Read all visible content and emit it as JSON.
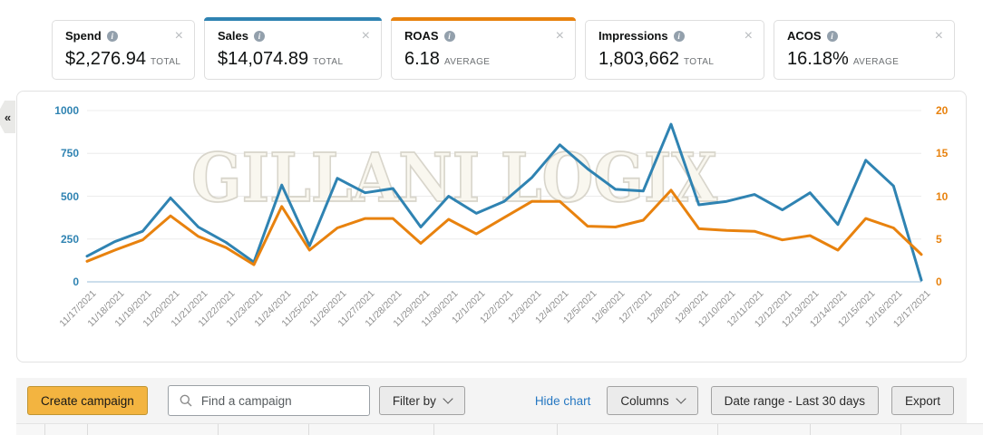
{
  "metrics": {
    "cards": [
      {
        "label": "Spend",
        "value": "$2,276.94",
        "suffix": "TOTAL",
        "accent": ""
      },
      {
        "label": "Sales",
        "value": "$14,074.89",
        "suffix": "TOTAL",
        "accent": "#2f83b2"
      },
      {
        "label": "ROAS",
        "value": "6.18",
        "suffix": "AVERAGE",
        "accent": "#e8820e"
      },
      {
        "label": "Impressions",
        "value": "1,803,662",
        "suffix": "TOTAL",
        "accent": ""
      },
      {
        "label": "ACOS",
        "value": "16.18%",
        "suffix": "AVERAGE",
        "accent": ""
      }
    ],
    "info_icon": "i",
    "close_icon": "×"
  },
  "chart_panel": {
    "collapse_icon": "«"
  },
  "chart_data": {
    "type": "line",
    "x": [
      "11/17/2021",
      "11/18/2021",
      "11/19/2021",
      "11/20/2021",
      "11/21/2021",
      "11/22/2021",
      "11/23/2021",
      "11/24/2021",
      "11/25/2021",
      "11/26/2021",
      "11/27/2021",
      "11/28/2021",
      "11/29/2021",
      "11/30/2021",
      "12/1/2021",
      "12/2/2021",
      "12/3/2021",
      "12/4/2021",
      "12/5/2021",
      "12/6/2021",
      "12/7/2021",
      "12/8/2021",
      "12/9/2021",
      "12/10/2021",
      "12/11/2021",
      "12/12/2021",
      "12/13/2021",
      "12/14/2021",
      "12/15/2021",
      "12/16/2021",
      "12/17/2021"
    ],
    "series": [
      {
        "name": "Sales",
        "axis": "left",
        "color": "#2f83b2",
        "values": [
          150,
          235,
          295,
          490,
          320,
          230,
          115,
          565,
          210,
          605,
          520,
          545,
          320,
          500,
          400,
          470,
          610,
          800,
          660,
          540,
          530,
          920,
          450,
          470,
          510,
          420,
          520,
          335,
          710,
          560,
          10
        ]
      },
      {
        "name": "ROAS",
        "axis": "right",
        "color": "#e8820e",
        "values": [
          2.4,
          3.7,
          4.9,
          7.7,
          5.3,
          4.0,
          2.0,
          8.8,
          3.7,
          6.3,
          7.4,
          7.4,
          4.5,
          7.3,
          5.6,
          7.5,
          9.4,
          9.4,
          6.5,
          6.4,
          7.2,
          10.7,
          6.2,
          6.0,
          5.9,
          4.9,
          5.4,
          3.7,
          7.4,
          6.3,
          3.2
        ]
      }
    ],
    "left_axis": {
      "ticks": [
        0,
        250,
        500,
        750,
        1000
      ],
      "range": [
        0,
        1000
      ],
      "color": "#2f83b2"
    },
    "right_axis": {
      "ticks": [
        0,
        5,
        10,
        15,
        20
      ],
      "range": [
        0,
        20
      ],
      "color": "#e8820e"
    },
    "watermark": "GILLANI LOGIX",
    "grid": true,
    "legend": "none"
  },
  "toolbar": {
    "create_campaign_label": "Create campaign",
    "search_placeholder": "Find a campaign",
    "filter_by_label": "Filter by",
    "hide_chart_label": "Hide chart",
    "columns_label": "Columns",
    "date_range_label": "Date range - Last 30 days",
    "export_label": "Export"
  }
}
